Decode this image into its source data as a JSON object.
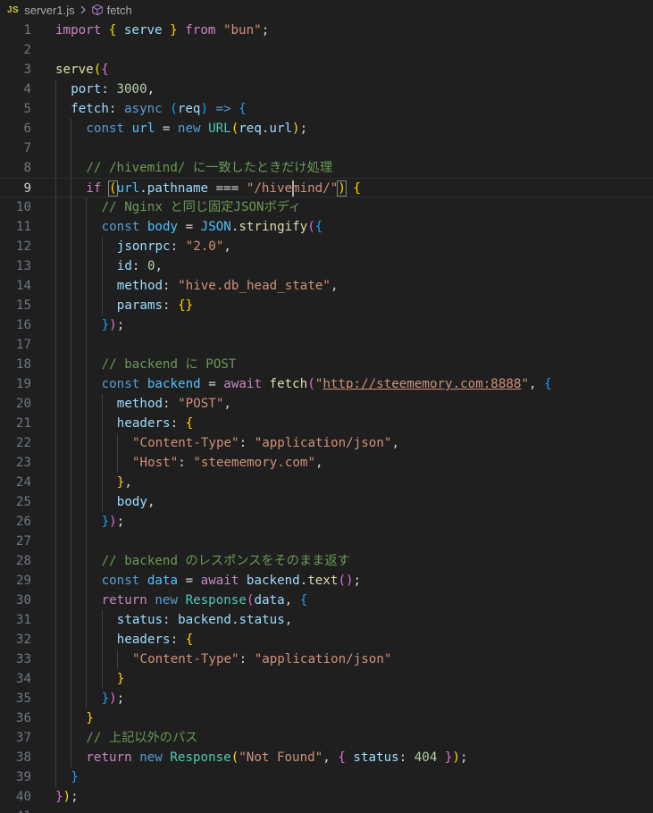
{
  "breadcrumb": {
    "file_badge": "JS",
    "file_name": "server1.js",
    "symbol_name": "fetch"
  },
  "colors": {
    "keyword_control": "#c586c0",
    "keyword_storage": "#569cd6",
    "variable": "#9cdcfe",
    "function": "#dcdcaa",
    "string": "#ce9178",
    "number": "#b5cea8",
    "comment": "#6a9955",
    "class": "#4ec9b0",
    "constant": "#4fc1ff",
    "bracket1": "#ffd700",
    "bracket2": "#da70d6",
    "bracket3": "#179fff",
    "default": "#d4d4d4"
  },
  "editor": {
    "current_line": 9,
    "lines": [
      {
        "n": "1",
        "indent": 0,
        "tokens": [
          [
            "import",
            "keyword_control"
          ],
          [
            " ",
            "default"
          ],
          [
            "{",
            "bracket1"
          ],
          [
            " ",
            "default"
          ],
          [
            "serve",
            "variable"
          ],
          [
            " ",
            "default"
          ],
          [
            "}",
            "bracket1"
          ],
          [
            " ",
            "default"
          ],
          [
            "from",
            "keyword_control"
          ],
          [
            " ",
            "default"
          ],
          [
            "\"bun\"",
            "string"
          ],
          [
            ";",
            "default"
          ]
        ]
      },
      {
        "n": "2",
        "indent": 0,
        "tokens": []
      },
      {
        "n": "3",
        "indent": 0,
        "tokens": [
          [
            "serve",
            "function"
          ],
          [
            "(",
            "bracket1"
          ],
          [
            "{",
            "bracket2"
          ]
        ]
      },
      {
        "n": "4",
        "indent": 1,
        "tokens": [
          [
            "port",
            "variable"
          ],
          [
            ": ",
            "default"
          ],
          [
            "3000",
            "number"
          ],
          [
            ",",
            "default"
          ]
        ]
      },
      {
        "n": "5",
        "indent": 1,
        "tokens": [
          [
            "fetch",
            "variable"
          ],
          [
            ": ",
            "default"
          ],
          [
            "async",
            "keyword_storage"
          ],
          [
            " ",
            "default"
          ],
          [
            "(",
            "bracket3"
          ],
          [
            "req",
            "variable"
          ],
          [
            ")",
            "bracket3"
          ],
          [
            " ",
            "default"
          ],
          [
            "=>",
            "keyword_storage"
          ],
          [
            " ",
            "default"
          ],
          [
            "{",
            "bracket3"
          ]
        ]
      },
      {
        "n": "6",
        "indent": 2,
        "tokens": [
          [
            "const",
            "keyword_storage"
          ],
          [
            " ",
            "default"
          ],
          [
            "url",
            "constant"
          ],
          [
            " = ",
            "default"
          ],
          [
            "new",
            "keyword_storage"
          ],
          [
            " ",
            "default"
          ],
          [
            "URL",
            "class"
          ],
          [
            "(",
            "bracket1"
          ],
          [
            "req",
            "variable"
          ],
          [
            ".",
            "default"
          ],
          [
            "url",
            "variable"
          ],
          [
            ")",
            "bracket1"
          ],
          [
            ";",
            "default"
          ]
        ]
      },
      {
        "n": "7",
        "indent": 2,
        "tokens": []
      },
      {
        "n": "8",
        "indent": 2,
        "tokens": [
          [
            "// /hivemind/ に一致したときだけ処理",
            "comment"
          ]
        ]
      },
      {
        "n": "9",
        "indent": 2,
        "tokens": [
          [
            "if",
            "keyword_control"
          ],
          [
            " ",
            "default"
          ],
          [
            "(",
            "bracket1"
          ],
          [
            "url",
            "constant"
          ],
          [
            ".",
            "default"
          ],
          [
            "pathname",
            "variable"
          ],
          [
            " === ",
            "default"
          ],
          [
            "\"/hivemind/\"",
            "string"
          ],
          [
            ")",
            "bracket1"
          ],
          [
            " ",
            "default"
          ],
          [
            "{",
            "bracket1"
          ]
        ]
      },
      {
        "n": "10",
        "indent": 3,
        "tokens": [
          [
            "// Nginx と同じ固定JSONボディ",
            "comment"
          ]
        ]
      },
      {
        "n": "11",
        "indent": 3,
        "tokens": [
          [
            "const",
            "keyword_storage"
          ],
          [
            " ",
            "default"
          ],
          [
            "body",
            "constant"
          ],
          [
            " = ",
            "default"
          ],
          [
            "JSON",
            "constant"
          ],
          [
            ".",
            "default"
          ],
          [
            "stringify",
            "function"
          ],
          [
            "(",
            "bracket2"
          ],
          [
            "{",
            "bracket3"
          ]
        ]
      },
      {
        "n": "12",
        "indent": 4,
        "tokens": [
          [
            "jsonrpc",
            "variable"
          ],
          [
            ": ",
            "default"
          ],
          [
            "\"2.0\"",
            "string"
          ],
          [
            ",",
            "default"
          ]
        ]
      },
      {
        "n": "13",
        "indent": 4,
        "tokens": [
          [
            "id",
            "variable"
          ],
          [
            ": ",
            "default"
          ],
          [
            "0",
            "number"
          ],
          [
            ",",
            "default"
          ]
        ]
      },
      {
        "n": "14",
        "indent": 4,
        "tokens": [
          [
            "method",
            "variable"
          ],
          [
            ": ",
            "default"
          ],
          [
            "\"hive.db_head_state\"",
            "string"
          ],
          [
            ",",
            "default"
          ]
        ]
      },
      {
        "n": "15",
        "indent": 4,
        "tokens": [
          [
            "params",
            "variable"
          ],
          [
            ": ",
            "default"
          ],
          [
            "{}",
            "bracket1"
          ]
        ]
      },
      {
        "n": "16",
        "indent": 3,
        "tokens": [
          [
            "}",
            "bracket3"
          ],
          [
            ")",
            "bracket2"
          ],
          [
            ";",
            "default"
          ]
        ]
      },
      {
        "n": "17",
        "indent": 3,
        "tokens": []
      },
      {
        "n": "18",
        "indent": 3,
        "tokens": [
          [
            "// backend に POST",
            "comment"
          ]
        ]
      },
      {
        "n": "19",
        "indent": 3,
        "tokens": [
          [
            "const",
            "keyword_storage"
          ],
          [
            " ",
            "default"
          ],
          [
            "backend",
            "constant"
          ],
          [
            " = ",
            "default"
          ],
          [
            "await",
            "keyword_control"
          ],
          [
            " ",
            "default"
          ],
          [
            "fetch",
            "function"
          ],
          [
            "(",
            "bracket2"
          ],
          [
            "\"",
            "string"
          ],
          [
            "http://steememory.com:8888",
            "string_link"
          ],
          [
            "\"",
            "string"
          ],
          [
            ", ",
            "default"
          ],
          [
            "{",
            "bracket3"
          ]
        ]
      },
      {
        "n": "20",
        "indent": 4,
        "tokens": [
          [
            "method",
            "variable"
          ],
          [
            ": ",
            "default"
          ],
          [
            "\"POST\"",
            "string"
          ],
          [
            ",",
            "default"
          ]
        ]
      },
      {
        "n": "21",
        "indent": 4,
        "tokens": [
          [
            "headers",
            "variable"
          ],
          [
            ": ",
            "default"
          ],
          [
            "{",
            "bracket1"
          ]
        ]
      },
      {
        "n": "22",
        "indent": 5,
        "tokens": [
          [
            "\"Content-Type\"",
            "string"
          ],
          [
            ": ",
            "default"
          ],
          [
            "\"application/json\"",
            "string"
          ],
          [
            ",",
            "default"
          ]
        ]
      },
      {
        "n": "23",
        "indent": 5,
        "tokens": [
          [
            "\"Host\"",
            "string"
          ],
          [
            ": ",
            "default"
          ],
          [
            "\"steememory.com\"",
            "string"
          ],
          [
            ",",
            "default"
          ]
        ]
      },
      {
        "n": "24",
        "indent": 4,
        "tokens": [
          [
            "}",
            "bracket1"
          ],
          [
            ",",
            "default"
          ]
        ]
      },
      {
        "n": "25",
        "indent": 4,
        "tokens": [
          [
            "body",
            "variable"
          ],
          [
            ",",
            "default"
          ]
        ]
      },
      {
        "n": "26",
        "indent": 3,
        "tokens": [
          [
            "}",
            "bracket3"
          ],
          [
            ")",
            "bracket2"
          ],
          [
            ";",
            "default"
          ]
        ]
      },
      {
        "n": "27",
        "indent": 3,
        "tokens": []
      },
      {
        "n": "28",
        "indent": 3,
        "tokens": [
          [
            "// backend のレスポンスをそのまま返す",
            "comment"
          ]
        ]
      },
      {
        "n": "29",
        "indent": 3,
        "tokens": [
          [
            "const",
            "keyword_storage"
          ],
          [
            " ",
            "default"
          ],
          [
            "data",
            "constant"
          ],
          [
            " = ",
            "default"
          ],
          [
            "await",
            "keyword_control"
          ],
          [
            " ",
            "default"
          ],
          [
            "backend",
            "variable"
          ],
          [
            ".",
            "default"
          ],
          [
            "text",
            "function"
          ],
          [
            "()",
            "bracket2"
          ],
          [
            ";",
            "default"
          ]
        ]
      },
      {
        "n": "30",
        "indent": 3,
        "tokens": [
          [
            "return",
            "keyword_control"
          ],
          [
            " ",
            "default"
          ],
          [
            "new",
            "keyword_storage"
          ],
          [
            " ",
            "default"
          ],
          [
            "Response",
            "class"
          ],
          [
            "(",
            "bracket2"
          ],
          [
            "data",
            "variable"
          ],
          [
            ", ",
            "default"
          ],
          [
            "{",
            "bracket3"
          ]
        ]
      },
      {
        "n": "31",
        "indent": 4,
        "tokens": [
          [
            "status",
            "variable"
          ],
          [
            ": ",
            "default"
          ],
          [
            "backend",
            "variable"
          ],
          [
            ".",
            "default"
          ],
          [
            "status",
            "variable"
          ],
          [
            ",",
            "default"
          ]
        ]
      },
      {
        "n": "32",
        "indent": 4,
        "tokens": [
          [
            "headers",
            "variable"
          ],
          [
            ": ",
            "default"
          ],
          [
            "{",
            "bracket1"
          ]
        ]
      },
      {
        "n": "33",
        "indent": 5,
        "tokens": [
          [
            "\"Content-Type\"",
            "string"
          ],
          [
            ": ",
            "default"
          ],
          [
            "\"application/json\"",
            "string"
          ]
        ]
      },
      {
        "n": "34",
        "indent": 4,
        "tokens": [
          [
            "}",
            "bracket1"
          ]
        ]
      },
      {
        "n": "35",
        "indent": 3,
        "tokens": [
          [
            "}",
            "bracket3"
          ],
          [
            ")",
            "bracket2"
          ],
          [
            ";",
            "default"
          ]
        ]
      },
      {
        "n": "36",
        "indent": 2,
        "tokens": [
          [
            "}",
            "bracket1"
          ]
        ]
      },
      {
        "n": "37",
        "indent": 2,
        "tokens": [
          [
            "// 上記以外のパス",
            "comment"
          ]
        ]
      },
      {
        "n": "38",
        "indent": 2,
        "tokens": [
          [
            "return",
            "keyword_control"
          ],
          [
            " ",
            "default"
          ],
          [
            "new",
            "keyword_storage"
          ],
          [
            " ",
            "default"
          ],
          [
            "Response",
            "class"
          ],
          [
            "(",
            "bracket1"
          ],
          [
            "\"Not Found\"",
            "string"
          ],
          [
            ", ",
            "default"
          ],
          [
            "{",
            "bracket2"
          ],
          [
            " ",
            "default"
          ],
          [
            "status",
            "variable"
          ],
          [
            ": ",
            "default"
          ],
          [
            "404",
            "number"
          ],
          [
            " ",
            "default"
          ],
          [
            "}",
            "bracket2"
          ],
          [
            ")",
            "bracket1"
          ],
          [
            ";",
            "default"
          ]
        ]
      },
      {
        "n": "39",
        "indent": 1,
        "tokens": [
          [
            "}",
            "bracket3"
          ]
        ]
      },
      {
        "n": "40",
        "indent": 0,
        "tokens": [
          [
            "}",
            "bracket2"
          ],
          [
            ")",
            "bracket1"
          ],
          [
            ";",
            "default"
          ]
        ]
      },
      {
        "n": "41",
        "indent": 0,
        "tokens": []
      }
    ]
  }
}
